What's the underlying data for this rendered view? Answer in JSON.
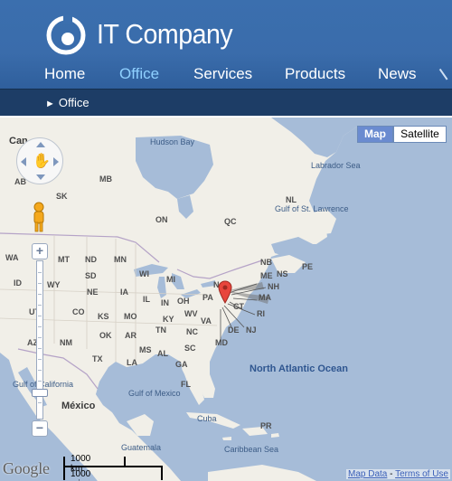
{
  "brand": {
    "name": "IT Company"
  },
  "nav": {
    "items": [
      {
        "label": "Home",
        "active": false
      },
      {
        "label": "Office",
        "active": true
      },
      {
        "label": "Services",
        "active": false
      },
      {
        "label": "Products",
        "active": false
      },
      {
        "label": "News",
        "active": false
      }
    ]
  },
  "breadcrumb": {
    "label": "Office"
  },
  "map": {
    "type_buttons": {
      "map": "Map",
      "satellite": "Satellite"
    },
    "provider": "Google",
    "scale": {
      "km": "1000 km",
      "mi": "1000 mi"
    },
    "footer": {
      "map_data": "Map Data",
      "separator": "-",
      "terms": "Terms of Use"
    },
    "labels": {
      "canada": "Can",
      "hudson_bay": "Hudson Bay",
      "labrador_sea": "Labrador Sea",
      "mb": "MB",
      "ab": "AB",
      "sk": "SK",
      "on": "ON",
      "qc": "QC",
      "nl": "NL",
      "gulf_st_lawrence": "Gulf of St. Lawrence",
      "nb": "NB",
      "pe": "PE",
      "ns": "NS",
      "wa": "WA",
      "mt": "MT",
      "nd": "ND",
      "mn": "MN",
      "id": "ID",
      "wy": "WY",
      "sd": "SD",
      "wi": "WI",
      "mi": "MI",
      "ut": "UT",
      "ne": "NE",
      "ia": "IA",
      "il": "IL",
      "in": "IN",
      "oh": "OH",
      "pa": "PA",
      "ny": "N",
      "me": "ME",
      "nh": "NH",
      "ma": "MA",
      "ct": "CT",
      "ri": "RI",
      "nj": "NJ",
      "de": "DE",
      "md": "MD",
      "co": "CO",
      "ks": "KS",
      "mo": "MO",
      "ky": "KY",
      "wv": "WV",
      "va": "VA",
      "az": "AZ",
      "nm": "NM",
      "ok": "OK",
      "ar": "AR",
      "tn": "TN",
      "nc": "NC",
      "sc": "SC",
      "tx": "TX",
      "la": "LA",
      "ms": "MS",
      "al": "AL",
      "ga": "GA",
      "fl": "FL",
      "gulf_california": "Gulf of California",
      "mexico": "México",
      "gulf_mexico": "Gulf of Mexico",
      "cuba": "Cuba",
      "pr": "PR",
      "north_atlantic": "North Atlantic Ocean",
      "guatemala": "Guatemala",
      "caribbean_sea": "Caribbean Sea"
    }
  },
  "colors": {
    "header_blue": "#3a6cab",
    "subbar_navy": "#1d3d66",
    "active_nav": "#8fd0ff",
    "water": "#a6bcd8",
    "land": "#f1efe8",
    "marker": "#e8453c"
  }
}
